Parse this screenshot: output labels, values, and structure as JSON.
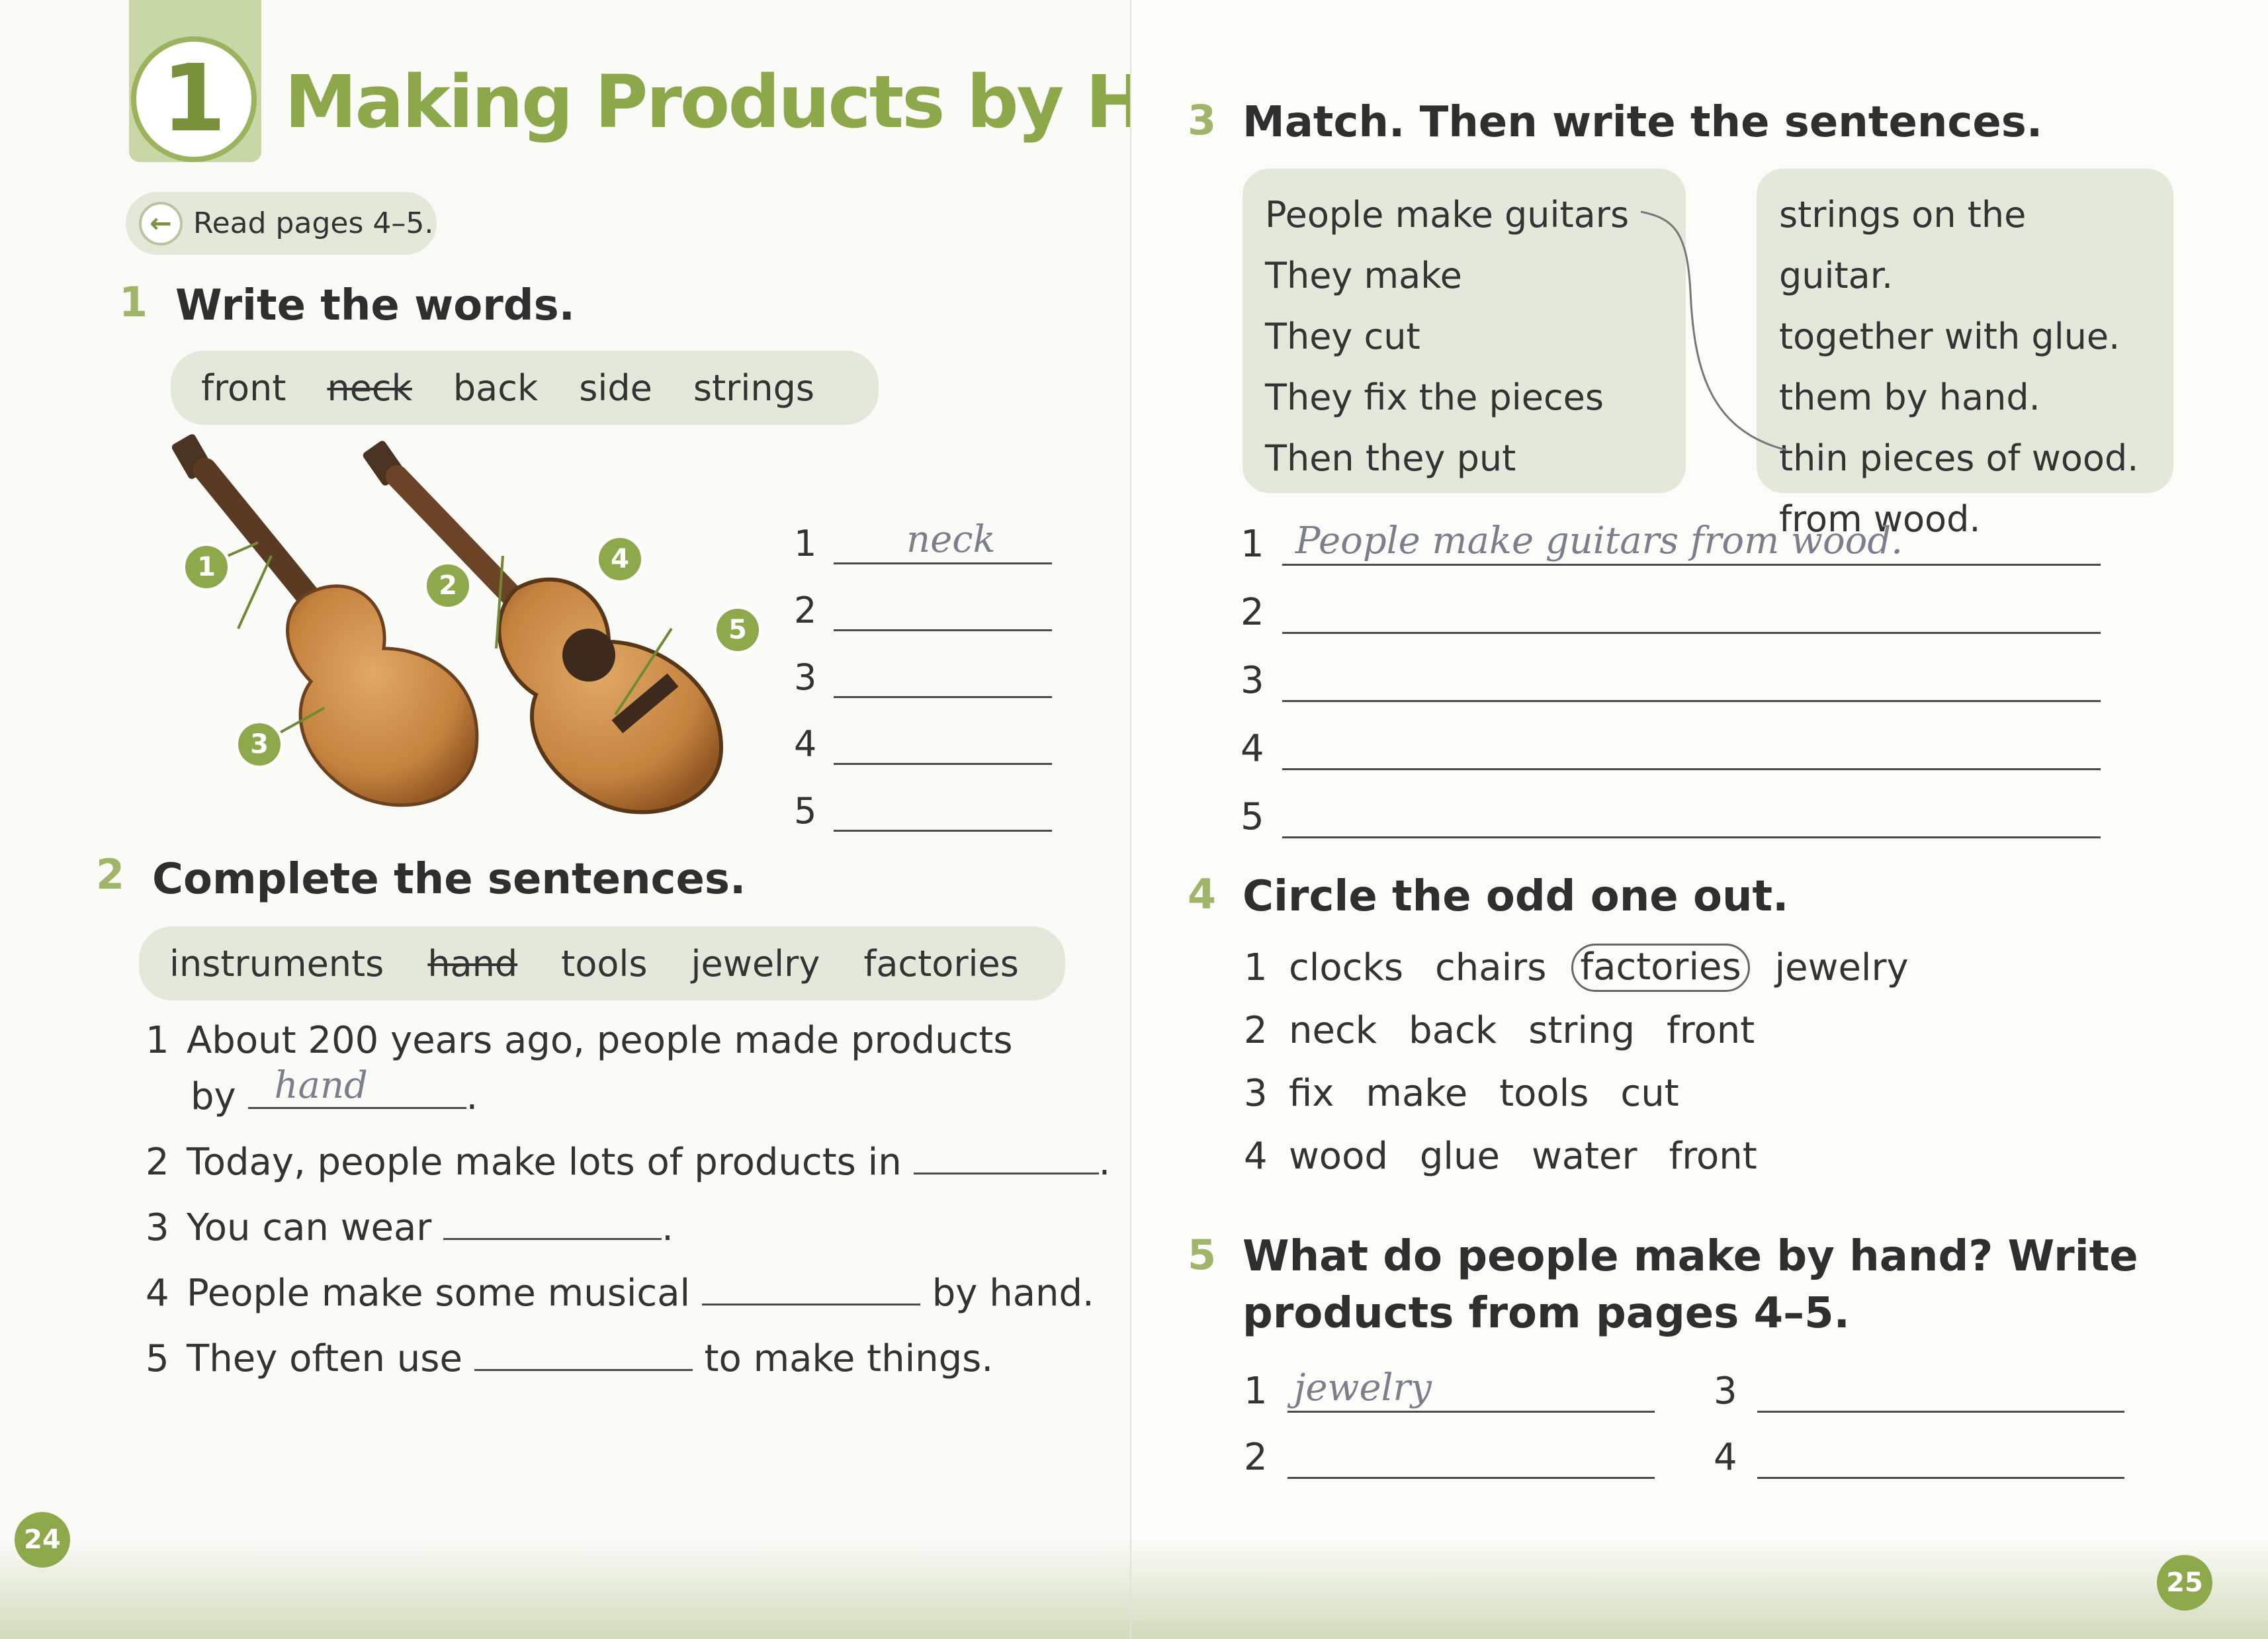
{
  "left_page": {
    "unit_number": "1",
    "unit_title": "Making Products by Hand",
    "read_pages": "Read pages 4–5.",
    "page_number": "24",
    "ex1": {
      "number": "1",
      "title": "Write the words.",
      "word_bank": [
        "front",
        "neck",
        "back",
        "side",
        "strings"
      ],
      "struck_word": "neck",
      "labels": [
        "1",
        "2",
        "3",
        "4",
        "5"
      ],
      "answers": [
        {
          "n": "1",
          "answer": "neck"
        },
        {
          "n": "2",
          "answer": ""
        },
        {
          "n": "3",
          "answer": ""
        },
        {
          "n": "4",
          "answer": ""
        },
        {
          "n": "5",
          "answer": ""
        }
      ]
    },
    "ex2": {
      "number": "2",
      "title": "Complete the sentences.",
      "word_bank": [
        "instruments",
        "hand",
        "tools",
        "jewelry",
        "factories"
      ],
      "struck_word": "hand",
      "sentences": [
        {
          "n": "1",
          "line1": "About 200 years ago, people made products",
          "before": "by",
          "answer": "hand",
          "after": "."
        },
        {
          "n": "2",
          "before": "Today, people make lots of products in",
          "answer": "",
          "after": "."
        },
        {
          "n": "3",
          "before": "You can wear",
          "answer": "",
          "after": "."
        },
        {
          "n": "4",
          "before": "People make some musical",
          "answer": "",
          "after": "by hand."
        },
        {
          "n": "5",
          "before": "They often use",
          "answer": "",
          "after": "to make things."
        }
      ]
    }
  },
  "right_page": {
    "page_number": "25",
    "ex3": {
      "number": "3",
      "title": "Match. Then write the sentences.",
      "left_column": [
        "People make guitars",
        "They make",
        "They cut",
        "They fix the pieces",
        "Then they put"
      ],
      "right_column": [
        "strings on the guitar.",
        "together with glue.",
        "them by hand.",
        "thin pieces of wood.",
        "from wood."
      ],
      "lines": [
        {
          "n": "1",
          "answer": "People make guitars from wood."
        },
        {
          "n": "2",
          "answer": ""
        },
        {
          "n": "3",
          "answer": ""
        },
        {
          "n": "4",
          "answer": ""
        },
        {
          "n": "5",
          "answer": ""
        }
      ]
    },
    "ex4": {
      "number": "4",
      "title": "Circle the odd one out.",
      "rows": [
        {
          "n": "1",
          "words": [
            "clocks",
            "chairs",
            "factories",
            "jewelry"
          ],
          "circled": "factories"
        },
        {
          "n": "2",
          "words": [
            "neck",
            "back",
            "string",
            "front"
          ]
        },
        {
          "n": "3",
          "words": [
            "fix",
            "make",
            "tools",
            "cut"
          ]
        },
        {
          "n": "4",
          "words": [
            "wood",
            "glue",
            "water",
            "front"
          ]
        }
      ]
    },
    "ex5": {
      "number": "5",
      "title_line1": "What do people make by hand? Write",
      "title_line2": "products from pages 4–5.",
      "answers": [
        {
          "n": "1",
          "answer": "jewelry"
        },
        {
          "n": "2",
          "answer": ""
        },
        {
          "n": "3",
          "answer": ""
        },
        {
          "n": "4",
          "answer": ""
        }
      ]
    }
  }
}
